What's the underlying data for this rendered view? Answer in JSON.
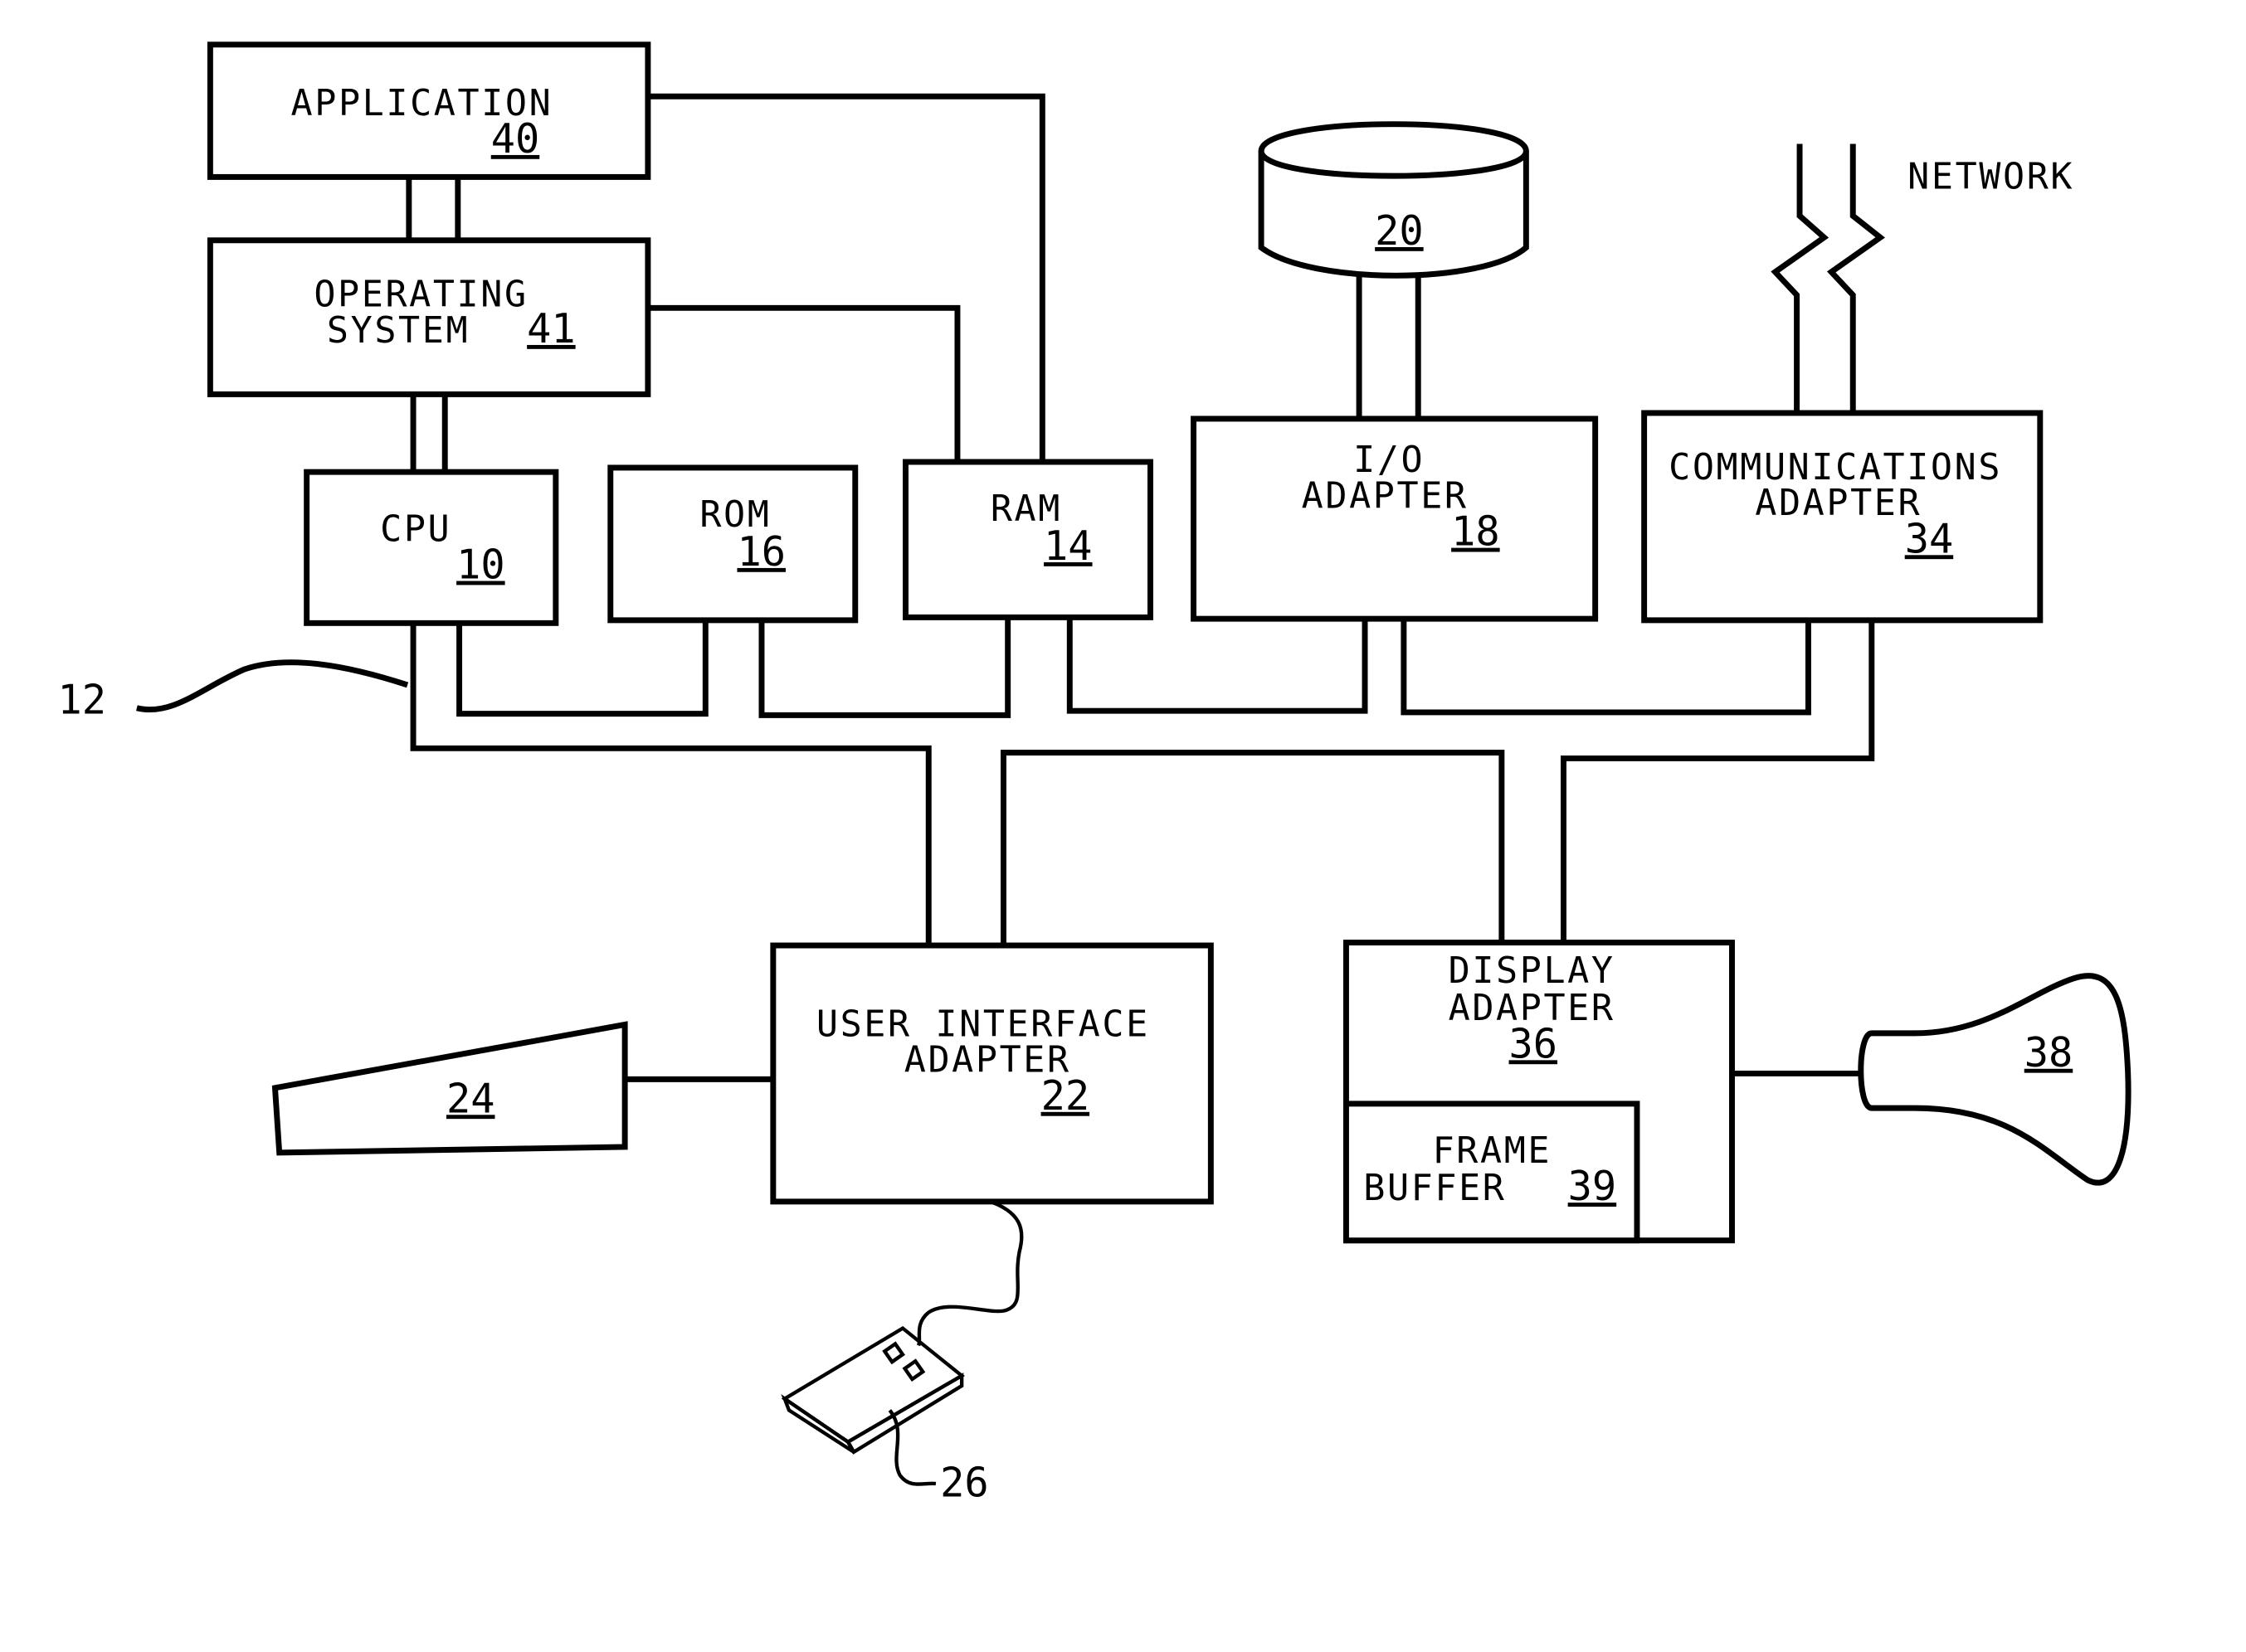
{
  "diagram": {
    "application": {
      "label": "APPLICATION",
      "ref": "40"
    },
    "operating_system": {
      "label_line1": "OPERATING",
      "label_line2": "SYSTEM",
      "ref": "41"
    },
    "cpu": {
      "label": "CPU",
      "ref": "10"
    },
    "rom": {
      "label": "ROM",
      "ref": "16"
    },
    "ram": {
      "label": "RAM",
      "ref": "14"
    },
    "disk": {
      "ref": "20"
    },
    "io_adapter": {
      "label_line1": "I/O",
      "label_line2": "ADAPTER",
      "ref": "18"
    },
    "network": {
      "label": "NETWORK"
    },
    "comm_adapter": {
      "label_line1": "COMMUNICATIONS",
      "label_line2": "ADAPTER",
      "ref": "34"
    },
    "bus": {
      "ref": "12"
    },
    "ui_adapter": {
      "label_line1": "USER INTERFACE",
      "label_line2": "ADAPTER",
      "ref": "22"
    },
    "keyboard": {
      "ref": "24"
    },
    "mouse": {
      "ref": "26"
    },
    "display_adapter": {
      "label_line1": "DISPLAY",
      "label_line2": "ADAPTER",
      "ref": "36"
    },
    "frame_buffer": {
      "label_line1": "FRAME",
      "label_line2": "BUFFER",
      "ref": "39"
    },
    "display": {
      "ref": "38"
    }
  }
}
